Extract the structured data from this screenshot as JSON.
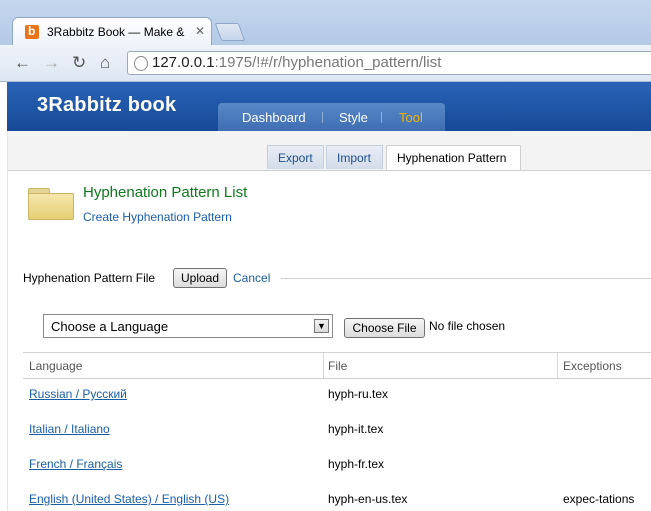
{
  "browser": {
    "tab_title": "3Rabbitz Book — Make &",
    "favicon_letter": "b",
    "url_host": "127.0.0.1",
    "url_rest": ":1975/!#/r/hyphenation_pattern/list"
  },
  "app": {
    "logo": "3Rabbitz book",
    "main_nav": [
      "Dashboard",
      "Style",
      "Tool"
    ],
    "sub_nav": [
      "Export",
      "Import",
      "Hyphenation Pattern"
    ]
  },
  "page": {
    "title": "Hyphenation Pattern List",
    "create_link": "Create Hyphenation Pattern"
  },
  "upload": {
    "label": "Hyphenation Pattern File",
    "upload_button": "Upload",
    "cancel_link": "Cancel",
    "language_select": "Choose a Language",
    "choose_file_button": "Choose File",
    "no_file": "No file chosen"
  },
  "table": {
    "headers": [
      "Language",
      "File",
      "Exceptions"
    ],
    "rows": [
      {
        "language": "Russian / Русский",
        "file": "hyph-ru.tex",
        "exceptions": ""
      },
      {
        "language": "Italian / Italiano",
        "file": "hyph-it.tex",
        "exceptions": ""
      },
      {
        "language": "French / Français",
        "file": "hyph-fr.tex",
        "exceptions": ""
      },
      {
        "language": "English (United States) / English (US)",
        "file": "hyph-en-us.tex",
        "exceptions": "expec-tations"
      }
    ]
  }
}
